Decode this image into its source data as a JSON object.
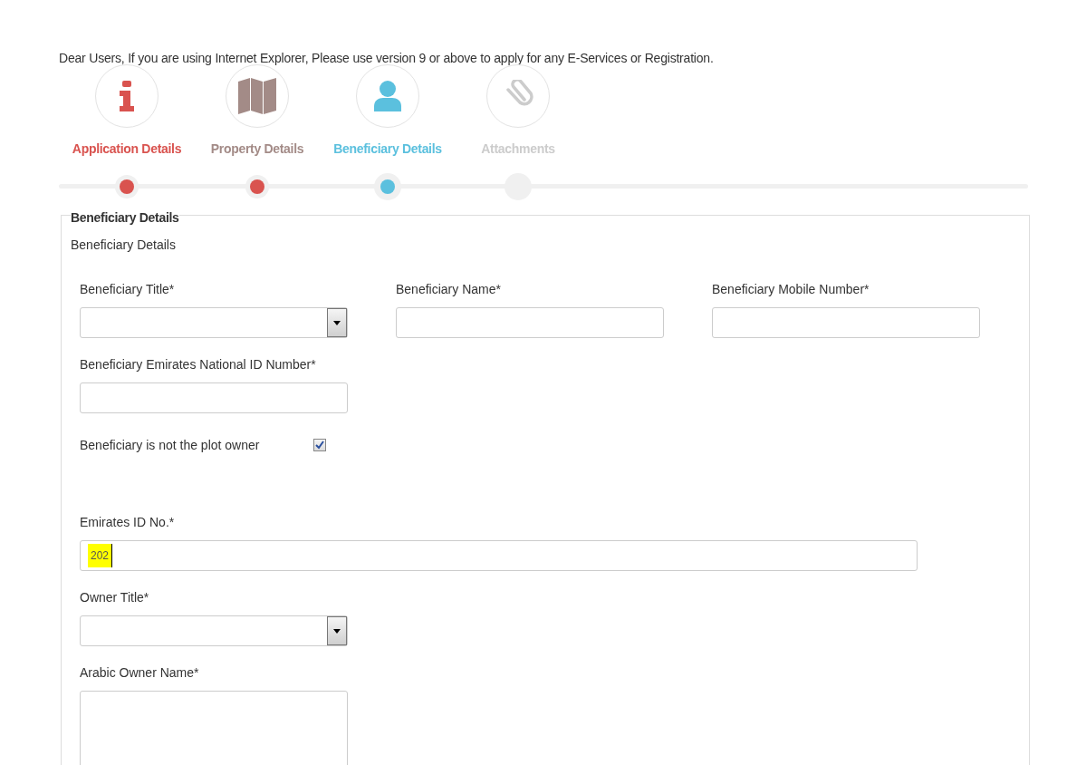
{
  "notice": "Dear Users, If you are using Internet Explorer, Please use version 9 or above to apply for any E-Services or Registration.",
  "steps": [
    {
      "label": "Application Details",
      "kind": "info",
      "completed": true,
      "selected": false,
      "color": "#d9534f"
    },
    {
      "label": "Property Details",
      "kind": "map",
      "completed": true,
      "selected": false,
      "color": "#a38b87"
    },
    {
      "label": "Beneficiary Details",
      "kind": "user",
      "completed": false,
      "selected": true,
      "color": "#5bc0de"
    },
    {
      "label": "Attachments",
      "kind": "paperclip",
      "completed": false,
      "selected": false,
      "color": "#cccccc"
    }
  ],
  "section": {
    "legend": "Beneficiary Details",
    "subtitle": "Beneficiary Details",
    "rows": [
      [
        {
          "kind": "select",
          "label": "Beneficiary Title*"
        },
        {
          "kind": "text",
          "label": "Beneficiary Name*"
        },
        {
          "kind": "text",
          "label": "Beneficiary Mobile Number*"
        }
      ],
      [
        {
          "kind": "text",
          "label": "Beneficiary Emirates National ID Number*"
        }
      ],
      [
        {
          "kind": "checkbox",
          "label": "Beneficiary is not the plot owner",
          "checked": true
        }
      ],
      [
        {
          "kind": "wide",
          "label": "Emirates ID No.*",
          "value": "202",
          "highlighted": true
        }
      ],
      [
        {
          "kind": "select",
          "label": "Owner Title*"
        }
      ],
      [
        {
          "kind": "textarea",
          "label": "Arabic Owner Name*"
        }
      ]
    ]
  }
}
